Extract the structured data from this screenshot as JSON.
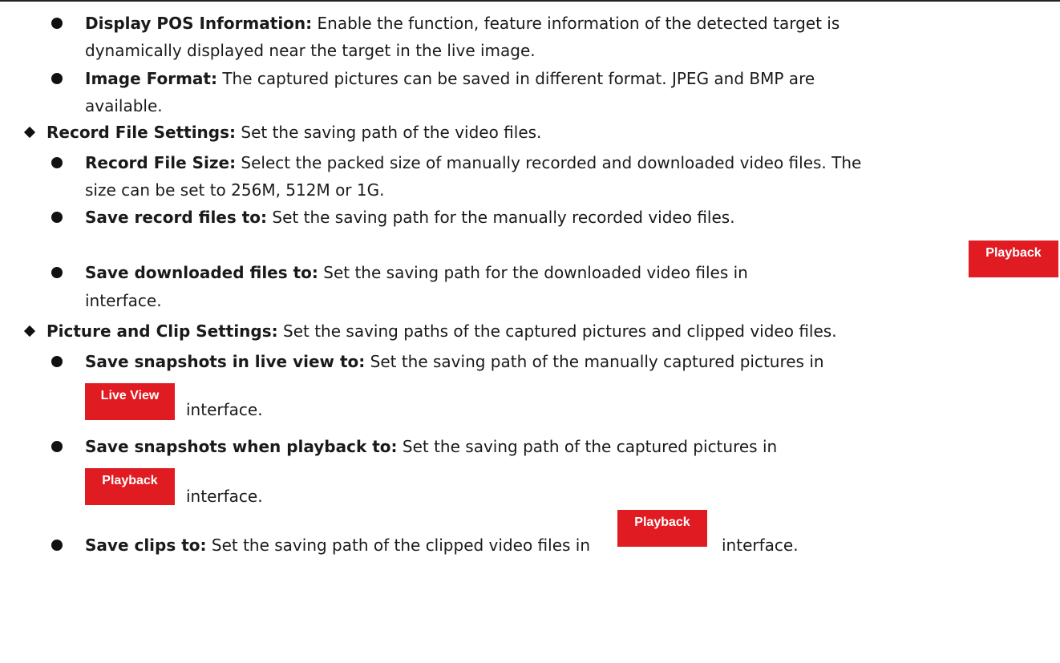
{
  "items": [
    {
      "bold": "Display POS Information:",
      "line1": " Enable the function, feature information of the detected target is",
      "line2": "dynamically displayed near the target in the live image."
    },
    {
      "bold": "Image Format:",
      "line1": " The captured pictures can be saved in different format. JPEG and BMP are",
      "line2": "available."
    },
    {
      "bold": "Record File Settings:",
      "line1": " Set the saving path of the video files."
    },
    {
      "bold": "Record File Size:",
      "line1": " Select the packed size of manually recorded and downloaded video files. The",
      "line2": "size can be set to 256M, 512M or 1G."
    },
    {
      "bold": "Save record files to:",
      "line1": " Set the saving path for the manually recorded video files."
    },
    {
      "bold": "Save downloaded files to:",
      "line1": " Set the saving path for the downloaded video files in",
      "line2": "interface."
    },
    {
      "bold": "Picture and Clip Settings:",
      "line1": " Set the saving paths of the captured pictures and clipped video files."
    },
    {
      "bold": "Save snapshots in live view to:",
      "line1": " Set the saving path of the manually captured pictures in",
      "line2": "interface."
    },
    {
      "bold": "Save snapshots when playback to:",
      "line1": " Set the saving path of the captured pictures in",
      "line2": "interface."
    },
    {
      "bold": "Save clips to:",
      "line1": " Set the saving path of the clipped video files in",
      "after": "interface."
    }
  ],
  "buttons": {
    "playback_1": "Playback",
    "live_view": "Live View",
    "playback_2": "Playback",
    "playback_3": "Playback"
  },
  "colors": {
    "accent": "#e01b22"
  }
}
